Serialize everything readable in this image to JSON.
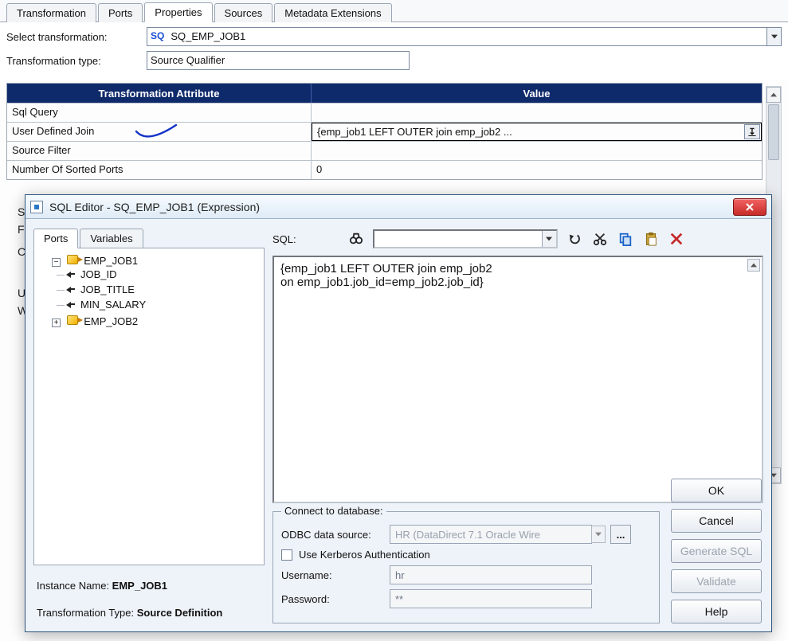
{
  "tabs": {
    "transformation": "Transformation",
    "ports": "Ports",
    "properties": "Properties",
    "sources": "Sources",
    "metadata": "Metadata Extensions"
  },
  "form": {
    "select_label": "Select transformation:",
    "select_prefix": "SQ",
    "select_value": "SQ_EMP_JOB1",
    "type_label": "Transformation type:",
    "type_value": "Source Qualifier"
  },
  "grid": {
    "head_attr": "Transformation Attribute",
    "head_val": "Value",
    "rows": [
      {
        "attr": "Sql Query",
        "val": ""
      },
      {
        "attr": "User Defined Join",
        "val": "{emp_job1 LEFT OUTER join emp_job2 ..."
      },
      {
        "attr": "Source Filter",
        "val": ""
      },
      {
        "attr": "Number Of Sorted Ports",
        "val": "0"
      }
    ]
  },
  "cutoff": {
    "s": "S",
    "f": "F",
    "c": "C",
    "u": "U",
    "w": "W"
  },
  "dialog": {
    "title": "SQL Editor - SQ_EMP_JOB1 (Expression)",
    "tabs": {
      "ports": "Ports",
      "variables": "Variables"
    },
    "tree": {
      "emp_job1": "EMP_JOB1",
      "job_id": "JOB_ID",
      "job_title": "JOB_TITLE",
      "min_salary": "MIN_SALARY",
      "emp_job2": "EMP_JOB2"
    },
    "instance_label": "Instance Name:",
    "instance_value": "EMP_JOB1",
    "ttype_label": "Transformation Type:",
    "ttype_value": "Source Definition",
    "sql_label": "SQL:",
    "sql_text": "{emp_job1 LEFT OUTER join emp_job2\non emp_job1.job_id=emp_job2.job_id}",
    "connect_legend": "Connect to database:",
    "odbc_label": "ODBC data source:",
    "odbc_value": "HR (DataDirect 7.1 Oracle Wire",
    "kerberos": "Use Kerberos Authentication",
    "user_label": "Username:",
    "user_value": "hr",
    "pass_label": "Password:",
    "pass_value": "**",
    "buttons": {
      "ok": "OK",
      "cancel": "Cancel",
      "gen": "Generate SQL",
      "validate": "Validate",
      "help": "Help"
    }
  }
}
